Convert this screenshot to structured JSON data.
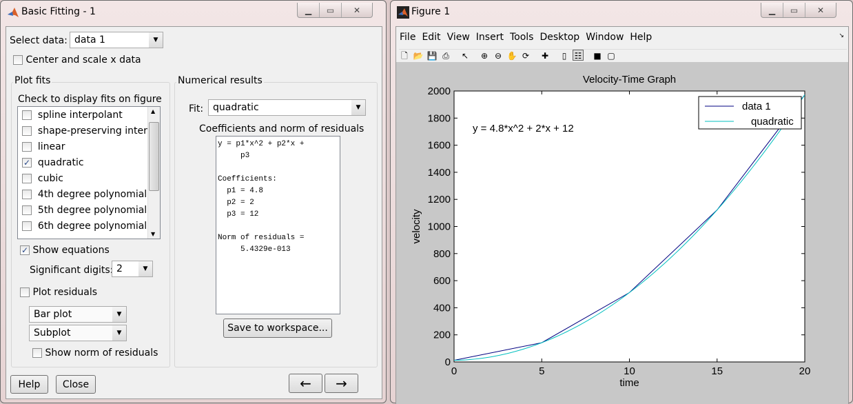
{
  "basic_fitting": {
    "title": "Basic Fitting - 1",
    "select_data_label": "Select data:",
    "select_data_value": "data 1",
    "center_scale_label": "Center and scale x data",
    "center_scale_checked": false,
    "plot_fits": {
      "title": "Plot fits",
      "instruction": "Check to display fits on figure",
      "items": [
        {
          "label": "spline interpolant",
          "checked": false
        },
        {
          "label": "shape-preserving inter...",
          "checked": false
        },
        {
          "label": "linear",
          "checked": false
        },
        {
          "label": "quadratic",
          "checked": true
        },
        {
          "label": "cubic",
          "checked": false
        },
        {
          "label": "4th degree polynomial",
          "checked": false
        },
        {
          "label": "5th degree polynomial",
          "checked": false
        },
        {
          "label": "6th degree polynomial",
          "checked": false
        }
      ],
      "show_equations_label": "Show equations",
      "show_equations_checked": true,
      "sig_digits_label": "Significant digits:",
      "sig_digits_value": "2",
      "plot_residuals_label": "Plot residuals",
      "plot_residuals_checked": false,
      "residual_plot_type": "Bar plot",
      "residual_location": "Subplot",
      "show_norm_label": "Show norm of residuals",
      "show_norm_checked": false
    },
    "numerical": {
      "title": "Numerical results",
      "fit_label": "Fit:",
      "fit_value": "quadratic",
      "coeff_title": "Coefficients and norm of residuals",
      "results_text": "y = p1*x^2 + p2*x +\n     p3\n\nCoefficients:\n  p1 = 4.8\n  p2 = 2\n  p3 = 12\n\nNorm of residuals =\n     5.4329e-013",
      "save_label": "Save to workspace..."
    },
    "help_label": "Help",
    "close_label": "Close",
    "back_label": "←",
    "forward_label": "→"
  },
  "figure": {
    "title": "Figure 1",
    "menu": [
      "File",
      "Edit",
      "View",
      "Insert",
      "Tools",
      "Desktop",
      "Window",
      "Help"
    ],
    "toolbar": [
      "new-file",
      "open-folder",
      "save",
      "print",
      "pointer",
      "zoom-in",
      "zoom-out",
      "pan-hand",
      "rotate-3d",
      "data-cursor",
      "colorbar",
      "legend",
      "hide-plot-tools",
      "show-plot-tools"
    ]
  },
  "chart_data": {
    "type": "line",
    "title": "Velocity-Time Graph",
    "xlabel": "time",
    "ylabel": "velocity",
    "xlim": [
      0,
      20
    ],
    "ylim": [
      0,
      2000
    ],
    "xticks": [
      0,
      5,
      10,
      15,
      20
    ],
    "yticks": [
      0,
      200,
      400,
      600,
      800,
      1000,
      1200,
      1400,
      1600,
      1800,
      2000
    ],
    "grid": false,
    "legend_position": "top-right",
    "annotation": "y = 4.8*x^2 + 2*x + 12",
    "series": [
      {
        "name": "data 1",
        "color": "#000080",
        "x": [
          0,
          5,
          10,
          15,
          20
        ],
        "y": [
          12,
          142,
          512,
          1122,
          1972
        ]
      },
      {
        "name": "quadratic",
        "color": "#00bfbf",
        "fit": {
          "p1": 4.8,
          "p2": 2,
          "p3": 12
        }
      }
    ]
  }
}
